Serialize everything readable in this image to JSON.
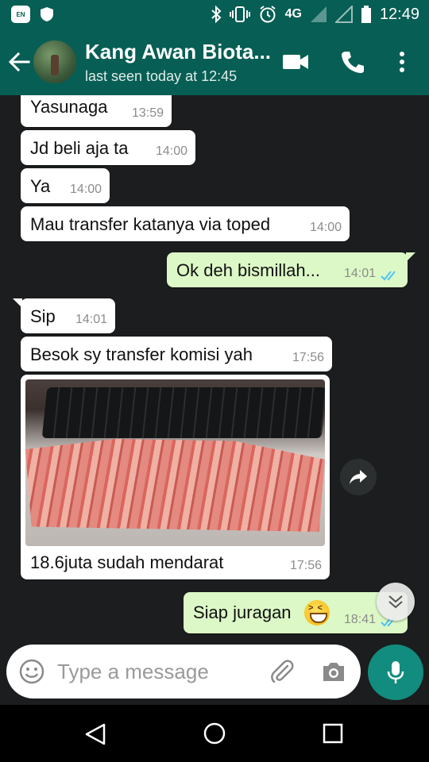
{
  "status_bar": {
    "badge_text": "EN",
    "network": "4G",
    "time": "12:49"
  },
  "header": {
    "contact_name": "Kang Awan Biota...",
    "last_seen": "last seen today at 12:45",
    "icons": [
      "back-arrow-icon",
      "video-call-icon",
      "phone-icon",
      "more-options-icon"
    ]
  },
  "messages": [
    {
      "direction": "incoming",
      "text": "Yasunaga",
      "time": "13:59"
    },
    {
      "direction": "incoming",
      "text": "Jd beli aja ta",
      "time": "14:00"
    },
    {
      "direction": "incoming",
      "text": "Ya",
      "time": "14:00"
    },
    {
      "direction": "incoming",
      "text": "Mau transfer katanya via toped",
      "time": "14:00"
    },
    {
      "direction": "outgoing",
      "text": "Ok deh bismillah...",
      "time": "14:01",
      "status": "read"
    },
    {
      "direction": "incoming",
      "text": "Sip",
      "time": "14:01"
    },
    {
      "direction": "incoming",
      "text": "Besok sy transfer komisi yah",
      "time": "17:56"
    },
    {
      "direction": "incoming",
      "type": "image",
      "caption": "18.6juta sudah mendarat",
      "time": "17:56"
    },
    {
      "direction": "outgoing",
      "text": "Siap juragan",
      "emoji": "grinning-squinting-face",
      "time": "18:41",
      "status": "read"
    }
  ],
  "composer": {
    "placeholder": "Type a message",
    "icons": [
      "emoji-icon",
      "attach-icon",
      "camera-icon",
      "mic-icon"
    ]
  },
  "colors": {
    "header": "#075e54",
    "outgoing_bubble": "#dcf8c6",
    "incoming_bubble": "#ffffff",
    "chat_background": "#1b1d1e",
    "read_ticks": "#4fc3f7",
    "mic_button": "#128c7e"
  }
}
